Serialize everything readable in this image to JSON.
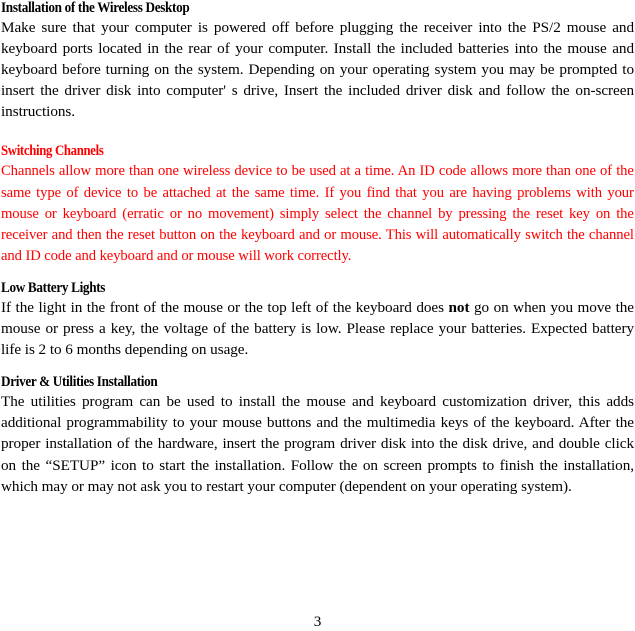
{
  "document": {
    "page_number": "3",
    "accent_color": "#ff0000",
    "text_color": "#000000",
    "background_color": "#ffffff"
  },
  "sections": {
    "installation": {
      "heading": "Installation of the Wireless Desktop",
      "body": "Make sure that your computer is powered off before plugging the receiver into the PS/2 mouse and keyboard ports located in the rear of your computer. Install the included batteries into the mouse and keyboard before turning on the system. Depending on your operating system you may be prompted to insert the driver disk into computer' s drive, Insert the included driver disk and follow the on-screen instructions."
    },
    "switching_channels": {
      "heading": "Switching Channels",
      "body": "Channels allow more than one wireless device to be used at a time. An ID code allows more than one of the same type of device to be attached at the same time. If you find that you are having problems with your mouse or keyboard (erratic or no movement) simply select the channel by pressing the reset key on the receiver and then the reset button on the keyboard and or mouse. This will automatically switch the channel and ID code and  keyboard and or mouse will work correctly."
    },
    "low_battery_lights": {
      "heading": "Low Battery Lights",
      "body_part1": "If the light in the front of the mouse or the top left of the keyboard does ",
      "body_emphasis": "not",
      "body_part2": " go on when you move the mouse or press a key, the voltage of the battery is low. Please replace your batteries. Expected battery life is 2 to 6 months depending on usage."
    },
    "driver_utilities": {
      "heading": "Driver & Utilities Installation",
      "body": "The utilities program can be used to install the mouse and keyboard customization driver, this adds additional programmability to your mouse buttons and the multimedia keys of the keyboard. After the proper installation of the hardware, insert the program driver disk into the disk drive, and double click on the “SETUP” icon to start the installation. Follow the on screen prompts to finish the installation, which may or may not ask you to restart your computer (dependent on your operating system)."
    }
  }
}
